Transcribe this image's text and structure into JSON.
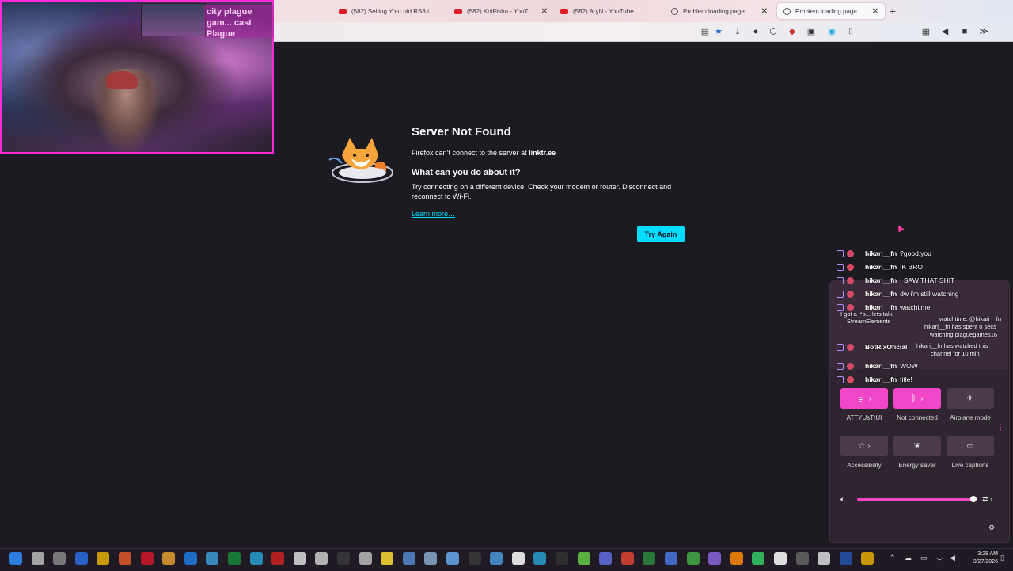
{
  "browser": {
    "tabs": [
      {
        "title": "(582) Selling Your old RS8 to a...",
        "icon": "youtube-icon"
      },
      {
        "title": "(582) KoiFishu - YouTube",
        "icon": "youtube-icon"
      },
      {
        "title": "(582) AryN - YouTube",
        "icon": "youtube-icon"
      },
      {
        "title": "Problem loading page",
        "icon": "globe-icon"
      },
      {
        "title": "Problem loading page",
        "icon": "globe-icon",
        "active": true
      }
    ]
  },
  "webcam": {
    "overlay_text": "city plague gam... cast Plague"
  },
  "error_page": {
    "title": "Server Not Found",
    "message_prefix": "Firefox can’t connect to the server at",
    "server": "linktr.ee",
    "subtitle": "What can you do about it?",
    "body": "Try connecting on a different device. Check your modem or router. Disconnect and reconnect to Wi-Fi.",
    "learn_more": "Learn more…",
    "try_again": "Try Again"
  },
  "chat": {
    "messages": [
      {
        "user": "hikari__fn",
        "text": "?good.you"
      },
      {
        "user": "hikari__fn",
        "text": "IK BRO"
      },
      {
        "user": "hikari__fn",
        "text": "I SAW THAT SHIT"
      },
      {
        "user": "hikari__fn",
        "text": "dw i'm still watching"
      },
      {
        "user": "hikari__fn",
        "text": "watchtime!"
      },
      {
        "user": "BotRixOficial",
        "text": ""
      },
      {
        "user": "hikari__fn",
        "text": "WOW"
      },
      {
        "user": "hikari__fn",
        "text": "title!"
      }
    ],
    "overlap_lines": [
      "I got a j*b... lets talk",
      "StreamElements",
      "watchtime: @hikari__fn",
      "hikari__fn has spent 0 secs",
      "watching plaguegames16",
      "hikari__fn has watched this",
      "channel for 10 min"
    ]
  },
  "quick_settings": {
    "tiles": [
      {
        "label": "ATTYUsTtUI",
        "icon": "wifi-icon",
        "on": true
      },
      {
        "label": "Not connected",
        "icon": "bluetooth-icon",
        "on": true
      },
      {
        "label": "Airplane mode",
        "icon": "airplane-icon",
        "on": false
      },
      {
        "label": "Accessibility",
        "icon": "accessibility-icon",
        "on": false
      },
      {
        "label": "Energy saver",
        "icon": "leaf-icon",
        "on": false
      },
      {
        "label": "Live captions",
        "icon": "captions-icon",
        "on": false
      }
    ],
    "volume_percent": 100
  },
  "taskbar": {
    "time": "3:28 AM",
    "date": "3/27/2026"
  },
  "colors": {
    "page_bg": "#1c1b22",
    "accent_cyan": "#00ddff",
    "accent_pink": "#f047c8",
    "cam_border": "#ff2bd6"
  }
}
